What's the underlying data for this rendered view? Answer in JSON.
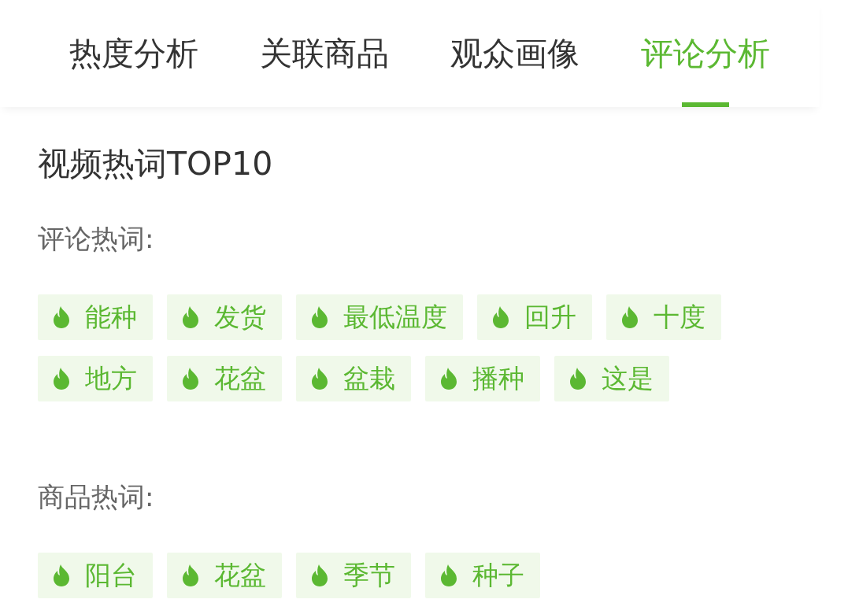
{
  "tabs": [
    {
      "label": "热度分析",
      "selected": false
    },
    {
      "label": "关联商品",
      "selected": false
    },
    {
      "label": "观众画像",
      "selected": false
    },
    {
      "label": "评论分析",
      "selected": true
    }
  ],
  "section": {
    "title": "视频热词TOP10",
    "groups": [
      {
        "label": "评论热词:",
        "tags": [
          "能种",
          "发货",
          "最低温度",
          "回升",
          "十度",
          "地方",
          "花盆",
          "盆栽",
          "播种",
          "这是"
        ]
      },
      {
        "label": "商品热词:",
        "tags": [
          "阳台",
          "花盆",
          "季节",
          "种子"
        ]
      }
    ]
  }
}
